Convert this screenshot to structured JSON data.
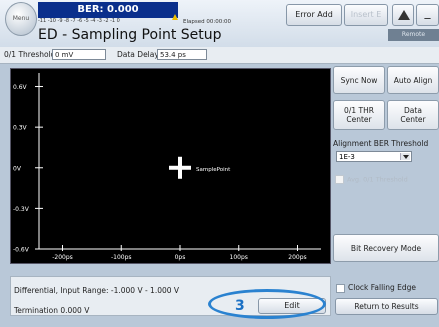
{
  "titlebar": {
    "menu_label": "Menu",
    "ber_label": "BER: 0.000",
    "ber_scale": "-11 -10  -9  -8  -7  -6  -5  -4  -3  -2  -1   0",
    "elapsed": "Elapsed 00:00:00",
    "title": "ED - Sampling Point Setup",
    "error_add": "Error Add",
    "insert_error": "Insert E",
    "minimize": "_",
    "remote": "Remote"
  },
  "params": {
    "threshold_label": "0/1 Threshold:",
    "threshold_value": "0 mV",
    "delay_label": "Data Delay:",
    "delay_value": "53.4 ps"
  },
  "plot": {
    "marker_label": "SamplePoint"
  },
  "chart_data": {
    "type": "scatter",
    "title": "",
    "xlabel": "",
    "ylabel": "",
    "x_ticks": [
      "-200ps",
      "-100ps",
      "0ps",
      "100ps",
      "200ps"
    ],
    "y_ticks": [
      "0.6V",
      "0.3V",
      "0V",
      "-0.3V",
      "-0.6V"
    ],
    "xlim": [
      -240,
      240
    ],
    "ylim": [
      -0.6,
      0.7
    ],
    "points": [
      {
        "x": 0,
        "y": 0.0,
        "label": "SamplePoint"
      }
    ]
  },
  "side": {
    "sync_now": "Sync Now",
    "auto_align": "Auto Align",
    "thr_center_l1": "0/1 THR",
    "thr_center_l2": "Center",
    "data_center_l1": "Data",
    "data_center_l2": "Center",
    "alignment_label": "Alignment BER Threshold",
    "alignment_value": "1E-3",
    "avg_threshold": "Avg. 0/1 Threshold",
    "bit_recovery": "Bit Recovery Mode",
    "clock_falling": "Clock Falling Edge",
    "return_results": "Return to Results"
  },
  "bottom": {
    "differential": "Differential, Input Range: -1.000 V - 1.000 V",
    "termination": "Termination 0.000 V",
    "edit": "Edit",
    "callout": "3"
  },
  "colors": {
    "ber_strip": "#0a2f8c",
    "plot_bg": "#000000",
    "callout": "#2a82d0"
  }
}
